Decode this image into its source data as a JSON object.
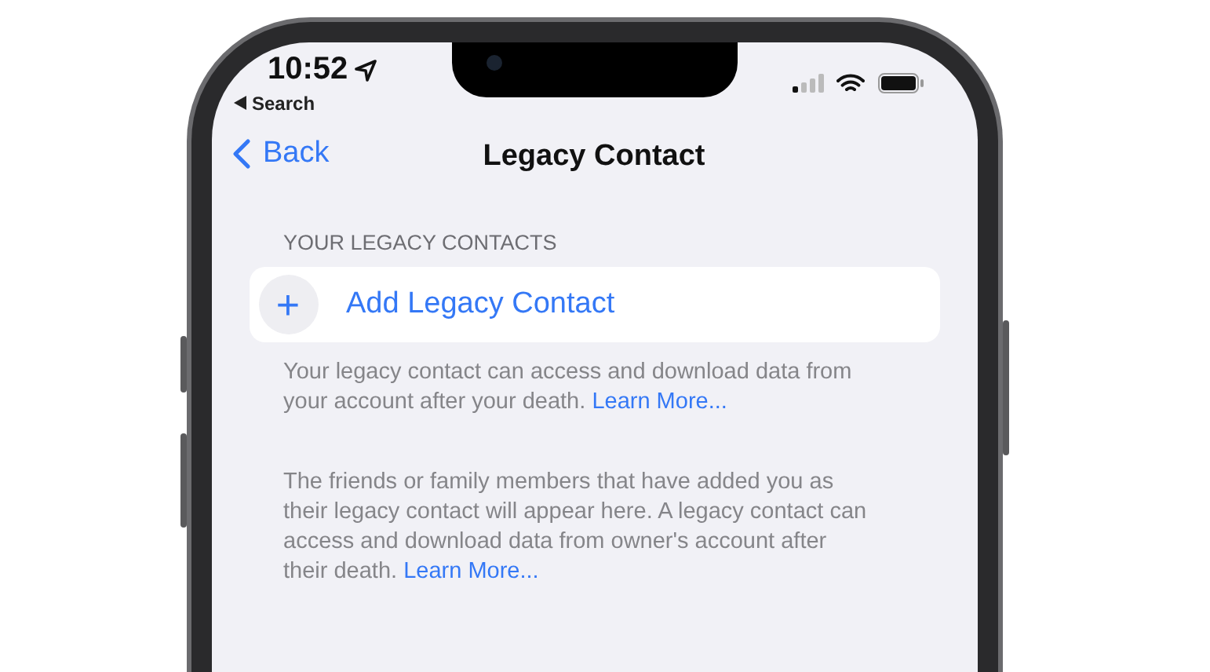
{
  "status_bar": {
    "time": "10:52",
    "back_app": "Search"
  },
  "nav": {
    "back": "Back",
    "title": "Legacy Contact"
  },
  "section": {
    "header": "YOUR LEGACY CONTACTS",
    "add_button": "Add Legacy Contact",
    "add_icon": "+",
    "footer": {
      "text": "Your legacy contact can access and download data from your account after your death.",
      "link": "Learn More..."
    }
  },
  "info": {
    "text": "The friends or family members that have added you as their legacy contact will appear here. A legacy contact can access and download data from owner's account after their death.",
    "link": "Learn More..."
  }
}
